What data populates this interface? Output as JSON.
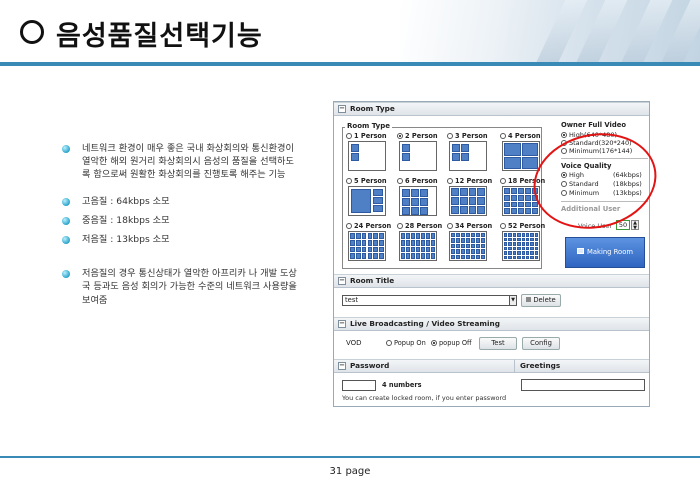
{
  "title": "음성품질선택기능",
  "bullets": [
    "네트워크 환경이 매우 좋은 국내 화상회의와 통신환경이 열악한 해외 원거리 화상회의시 음성의 품질을 선택하도록 함으로써 원활한 화상회의를 진행토록 해주는 기능",
    "고음질 : 64kbps 소모",
    "중음질 : 18kbps 소모",
    "저음질 : 13kbps 소모",
    "저음질의 경우 통신상태가 열악한 아프리카 나 개발 도상국 등과도 음성 회의가 가능한 수준의 네트워크 사용량을 보여줌"
  ],
  "room_type": {
    "header": "Room Type",
    "legend": "Room Type",
    "options": [
      {
        "label": "1 Person",
        "checked": false
      },
      {
        "label": "2 Person",
        "checked": true
      },
      {
        "label": "3 Person",
        "checked": false
      },
      {
        "label": "4 Person",
        "checked": false
      },
      {
        "label": "5 Person",
        "checked": false
      },
      {
        "label": "6 Person",
        "checked": false
      },
      {
        "label": "12 Person",
        "checked": false
      },
      {
        "label": "18 Person",
        "checked": false
      },
      {
        "label": "24 Person",
        "checked": false
      },
      {
        "label": "28 Person",
        "checked": false
      },
      {
        "label": "34 Person",
        "checked": false
      },
      {
        "label": "52 Person",
        "checked": false
      }
    ],
    "owner_video": {
      "label": "Owner Full Video",
      "options": [
        "High(640*480)",
        "Standard(320*240)",
        "Minimum(176*144)"
      ],
      "selected": 0
    },
    "voice_quality": {
      "label": "Voice Quality",
      "options": [
        {
          "name": "High",
          "rate": "(64kbps)"
        },
        {
          "name": "Standard",
          "rate": "(18kbps)"
        },
        {
          "name": "Minimum",
          "rate": "(13kbps)"
        }
      ],
      "selected": 0
    },
    "additional_user": {
      "label": "Additional User",
      "voice_user_label": "Voice User",
      "voice_user_value": "50"
    },
    "make_button": "Making Room"
  },
  "room_title": {
    "header": "Room Title",
    "value": "test",
    "delete_button": "Delete"
  },
  "live": {
    "header": "Live Broadcasting / Video Streaming",
    "vod_label": "VOD",
    "popup_on": "Popup On",
    "popup_off": "popup Off",
    "selected": "popup Off",
    "test_button": "Test",
    "config_button": "Config"
  },
  "password": {
    "header": "Password",
    "hint": "4 numbers",
    "note": "You can create locked room, if you enter password"
  },
  "greetings": {
    "header": "Greetings"
  },
  "page": "31 page",
  "colors": {
    "accent_line": "#3a8ab8",
    "highlight_ellipse": "#e31414",
    "tile_blue": "#4f7fc4"
  }
}
